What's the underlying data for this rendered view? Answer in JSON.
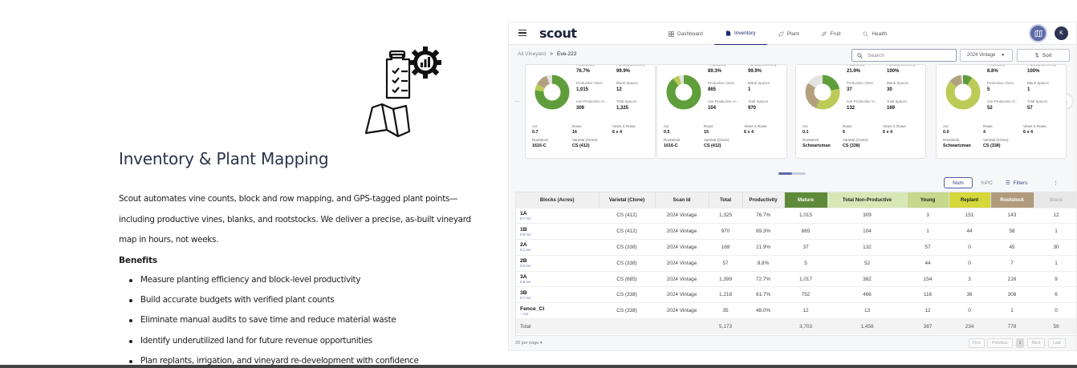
{
  "left": {
    "title": "Inventory & Plant Mapping",
    "intro": "Scout automates vine counts, block and row mapping, and GPS-tagged plant points—including productive vines, blanks, and rootstocks. We deliver a precise, as-built vineyard map in hours, not weeks.",
    "intro_lines": [
      "Scout automates vine counts, block and row mapping, and GPS-tagged plant points—",
      "including productive vines, blanks, and rootstocks. We deliver a precise, as-built vineyard",
      "map in hours, not weeks."
    ],
    "benefits_title": "Benefits",
    "benefits": [
      "Measure planting efficiency and block-level productivity",
      "Build accurate budgets with verified plant counts",
      "Eliminate manual audits to save time and reduce material waste",
      "Identify underutilized land for future revenue opportunities",
      "Plan replants, irrigation, and vineyard re-development with confidence"
    ],
    "icons": [
      "checklist-gear-icon",
      "folded-map-icon"
    ]
  },
  "app": {
    "brand": "scout",
    "nav": [
      {
        "label": "Dashboard",
        "icon": "dashboard-icon"
      },
      {
        "label": "Inventory",
        "icon": "document-icon",
        "active": true
      },
      {
        "label": "Plant",
        "icon": "plant-icon"
      },
      {
        "label": "Fruit",
        "icon": "leaf-icon"
      },
      {
        "label": "Health",
        "icon": "search-icon"
      }
    ],
    "avatar": "K",
    "breadcrumb": {
      "root": "All Vineyard",
      "sep": ">",
      "current": "Eve-222"
    },
    "search_placeholder": "Search",
    "vintage": "2024 Vintage",
    "sort": "Sort",
    "cards": [
      {
        "donut": [
          {
            "v": 76.7,
            "c": "#5f9e3a"
          },
          {
            "v": 6,
            "c": "#bccb58"
          },
          {
            "v": 12,
            "c": "#b3a07e"
          },
          {
            "v": 5.3,
            "c": "#e3e3e3"
          }
        ],
        "stats": [
          [
            "Productivity",
            "76.7%"
          ],
          [
            "Planting Efficiency",
            "99.9%"
          ],
          [
            "Productive Vines",
            "1,015"
          ],
          [
            "Blank Spaces",
            "12"
          ],
          [
            "non-Productive Vi...",
            "309"
          ],
          [
            "Total Spaces",
            "1,325"
          ]
        ],
        "foot": [
          [
            "Acr",
            "0.7"
          ],
          [
            "Rows",
            "16"
          ],
          [
            "Vines X Rows",
            "6 x 4"
          ],
          [
            "Rootstock",
            "1616-C"
          ],
          [
            "Varietal (Clone)",
            "CS (412)"
          ]
        ]
      },
      {
        "donut": [
          {
            "v": 89.3,
            "c": "#5f9e3a"
          },
          {
            "v": 6,
            "c": "#bccb58"
          },
          {
            "v": 4.7,
            "c": "#e3e3e3"
          }
        ],
        "stats": [
          [
            "Productivity",
            "89.3%"
          ],
          [
            "Planting Efficiency",
            "99.9%"
          ],
          [
            "Productive Vines",
            "865"
          ],
          [
            "Blank Spaces",
            "1"
          ],
          [
            "non-Productive Vi...",
            "104"
          ],
          [
            "Total Spaces",
            "970"
          ]
        ],
        "foot": [
          [
            "Acr",
            "0.5"
          ],
          [
            "Rows",
            "15"
          ],
          [
            "Vines X Rows",
            "6 x 4"
          ],
          [
            "Rootstock",
            "1616-C"
          ],
          [
            "Varietal (Clone)",
            "CS (412)"
          ]
        ]
      },
      {
        "donut": [
          {
            "v": 21.9,
            "c": "#5f9e3a"
          },
          {
            "v": 34,
            "c": "#bccb58"
          },
          {
            "v": 28,
            "c": "#b3a07e"
          },
          {
            "v": 16.1,
            "c": "#e3e3e3"
          }
        ],
        "stats": [
          [
            "Productivity",
            "21.9%"
          ],
          [
            "Planting Efficiency",
            "100%"
          ],
          [
            "Productive Vines",
            "37"
          ],
          [
            "Blank Spaces",
            "30"
          ],
          [
            "non-Productive Vi...",
            "132"
          ],
          [
            "Total Spaces",
            "169"
          ]
        ],
        "foot": [
          [
            "Acr",
            "0.1"
          ],
          [
            "Rows",
            "6"
          ],
          [
            "Vines X Rows",
            "6 x 4"
          ],
          [
            "Rootstock",
            "Schwartzman"
          ],
          [
            "Varietal (Clone)",
            "CS (338)"
          ]
        ]
      },
      {
        "donut": [
          {
            "v": 8.8,
            "c": "#5f9e3a"
          },
          {
            "v": 77,
            "c": "#bccb58"
          },
          {
            "v": 12,
            "c": "#b3a07e"
          },
          {
            "v": 2.2,
            "c": "#e3e3e3"
          }
        ],
        "stats": [
          [
            "Productivity",
            "8.8%"
          ],
          [
            "Planting Efficiency",
            "100%"
          ],
          [
            "Productive Vines",
            "5"
          ],
          [
            "Blank Spaces",
            "1"
          ],
          [
            "non-Productive Vi...",
            "52"
          ],
          [
            "Total Spaces",
            "57"
          ]
        ],
        "foot": [
          [
            "Acr",
            "0.0"
          ],
          [
            "Rows",
            "4"
          ],
          [
            "Vines X Rows",
            "6 x 4"
          ],
          [
            "Rootstock",
            "Schwartzman"
          ],
          [
            "Varietal (Clone)",
            "CS (338)"
          ]
        ]
      }
    ],
    "toggle": {
      "num": "Num",
      "pct": "%PC"
    },
    "filters": "Filters",
    "table": {
      "headers": [
        "Blocks (Acres)",
        "Varietal (Clone)",
        "Scan Id",
        "Total",
        "Productivity",
        "Mature",
        "Total Non-Productive",
        "Young",
        "Replant",
        "Rootstock",
        "Blank"
      ],
      "rows": [
        {
          "block": "1A",
          "acres": "0.7 Acr",
          "cells": [
            "CS (412)",
            "2024 Vintage",
            "1,325",
            "76.7%",
            "1,015",
            "309",
            "3",
            "151",
            "143",
            "12"
          ]
        },
        {
          "block": "1B",
          "acres": "0.5 Acr",
          "cells": [
            "CS (412)",
            "2024 Vintage",
            "970",
            "89.3%",
            "865",
            "104",
            "1",
            "44",
            "58",
            "1"
          ]
        },
        {
          "block": "2A",
          "acres": "0.1 Acr",
          "cells": [
            "CS (338)",
            "2024 Vintage",
            "169",
            "21.9%",
            "37",
            "132",
            "57",
            "0",
            "45",
            "30"
          ]
        },
        {
          "block": "2B",
          "acres": "0.0 Acr",
          "cells": [
            "CS (338)",
            "2024 Vintage",
            "57",
            "8.8%",
            "5",
            "52",
            "44",
            "0",
            "7",
            "1"
          ]
        },
        {
          "block": "3A",
          "acres": "0.8 Acr",
          "cells": [
            "CS (685)",
            "2024 Vintage",
            "1,399",
            "72.7%",
            "1,017",
            "382",
            "154",
            "3",
            "216",
            "9"
          ]
        },
        {
          "block": "3B",
          "acres": "0.7 Acr",
          "cells": [
            "CS (338)",
            "2024 Vintage",
            "1,218",
            "61.7%",
            "752",
            "466",
            "116",
            "36",
            "308",
            "6"
          ]
        },
        {
          "block": "Fence_Cl",
          "acres": "-- Acr",
          "cells": [
            "CS (338)",
            "2024 Vintage",
            "35",
            "48.0%",
            "12",
            "13",
            "12",
            "0",
            "1",
            "0"
          ]
        }
      ],
      "total": [
        "Total",
        "",
        "",
        "5,173",
        "",
        "3,703",
        "1,458",
        "387",
        "234",
        "778",
        "59"
      ]
    },
    "per_page": "20 per page",
    "pager": [
      "First",
      "Previous",
      "1",
      "Next",
      "Last"
    ]
  }
}
